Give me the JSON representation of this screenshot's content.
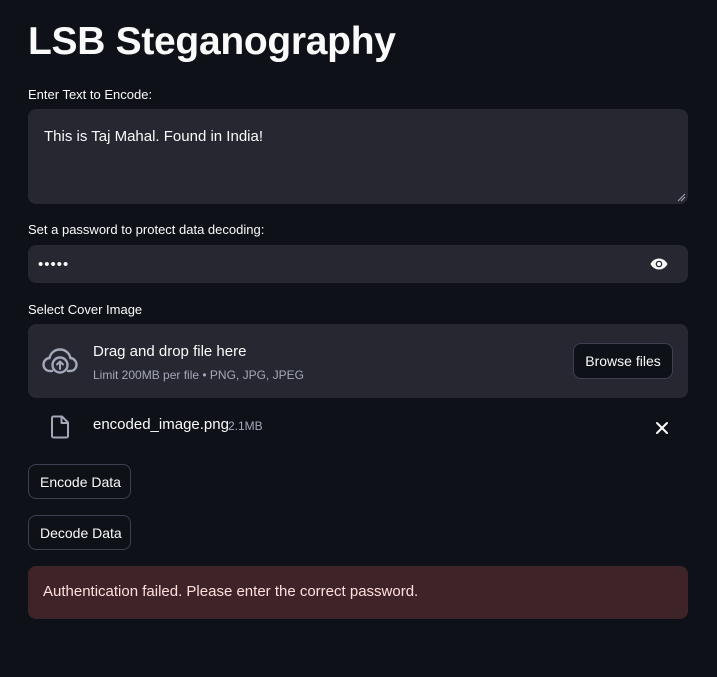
{
  "page": {
    "title": "LSB Steganography"
  },
  "text_input": {
    "label": "Enter Text to Encode:",
    "value": "This is Taj Mahal. Found in India!"
  },
  "password_input": {
    "label": "Set a password to protect data decoding:",
    "value": "•••••",
    "toggle_icon": "eye-icon"
  },
  "file_uploader": {
    "label": "Select Cover Image",
    "dropzone_text": "Drag and drop file here",
    "limit_text": "Limit 200MB per file • PNG, JPG, JPEG",
    "browse_label": "Browse files",
    "upload_icon": "cloud-upload-icon"
  },
  "uploaded_file": {
    "name": "encoded_image.png",
    "size": "2.1MB",
    "file_icon": "file-icon",
    "remove_icon": "close-icon"
  },
  "actions": {
    "encode_label": "Encode Data",
    "decode_label": "Decode Data"
  },
  "alert": {
    "type": "error",
    "message": "Authentication failed. Please enter the correct password."
  },
  "colors": {
    "background": "#0e1117",
    "input_bg": "#262730",
    "text": "#fafafa",
    "muted": "#a3a8b8",
    "error_bg": "#3e2428",
    "error_text": "#ffdede"
  }
}
